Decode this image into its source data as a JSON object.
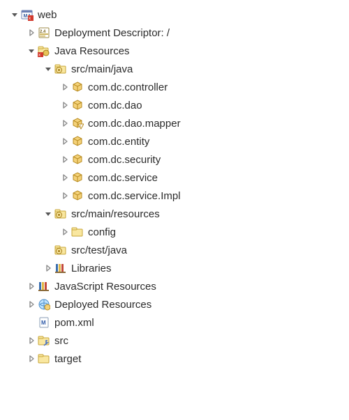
{
  "tree": [
    {
      "indent": 14,
      "state": "open",
      "icon": "web-project",
      "label": "web"
    },
    {
      "indent": 38,
      "state": "closed",
      "icon": "dd",
      "label": "Deployment Descriptor: /"
    },
    {
      "indent": 38,
      "state": "open",
      "icon": "java-res",
      "label": "Java Resources"
    },
    {
      "indent": 62,
      "state": "open",
      "icon": "src-folder",
      "label": "src/main/java"
    },
    {
      "indent": 86,
      "state": "closed",
      "icon": "package",
      "label": "com.dc.controller"
    },
    {
      "indent": 86,
      "state": "closed",
      "icon": "package",
      "label": "com.dc.dao"
    },
    {
      "indent": 86,
      "state": "closed",
      "icon": "package-err",
      "label": "com.dc.dao.mapper"
    },
    {
      "indent": 86,
      "state": "closed",
      "icon": "package",
      "label": "com.dc.entity"
    },
    {
      "indent": 86,
      "state": "closed",
      "icon": "package",
      "label": "com.dc.security"
    },
    {
      "indent": 86,
      "state": "closed",
      "icon": "package",
      "label": "com.dc.service"
    },
    {
      "indent": 86,
      "state": "closed",
      "icon": "package",
      "label": "com.dc.service.Impl"
    },
    {
      "indent": 62,
      "state": "open",
      "icon": "src-folder",
      "label": "src/main/resources"
    },
    {
      "indent": 86,
      "state": "closed",
      "icon": "folder",
      "label": "config"
    },
    {
      "indent": 62,
      "state": "leaf",
      "icon": "src-folder",
      "label": "src/test/java"
    },
    {
      "indent": 62,
      "state": "closed",
      "icon": "library",
      "label": "Libraries"
    },
    {
      "indent": 38,
      "state": "closed",
      "icon": "library",
      "label": "JavaScript Resources"
    },
    {
      "indent": 38,
      "state": "closed",
      "icon": "deployed",
      "label": "Deployed Resources"
    },
    {
      "indent": 38,
      "state": "leaf",
      "icon": "maven-file",
      "label": "pom.xml"
    },
    {
      "indent": 38,
      "state": "closed",
      "icon": "folder-link",
      "label": "src"
    },
    {
      "indent": 38,
      "state": "closed",
      "icon": "folder",
      "label": "target"
    }
  ]
}
